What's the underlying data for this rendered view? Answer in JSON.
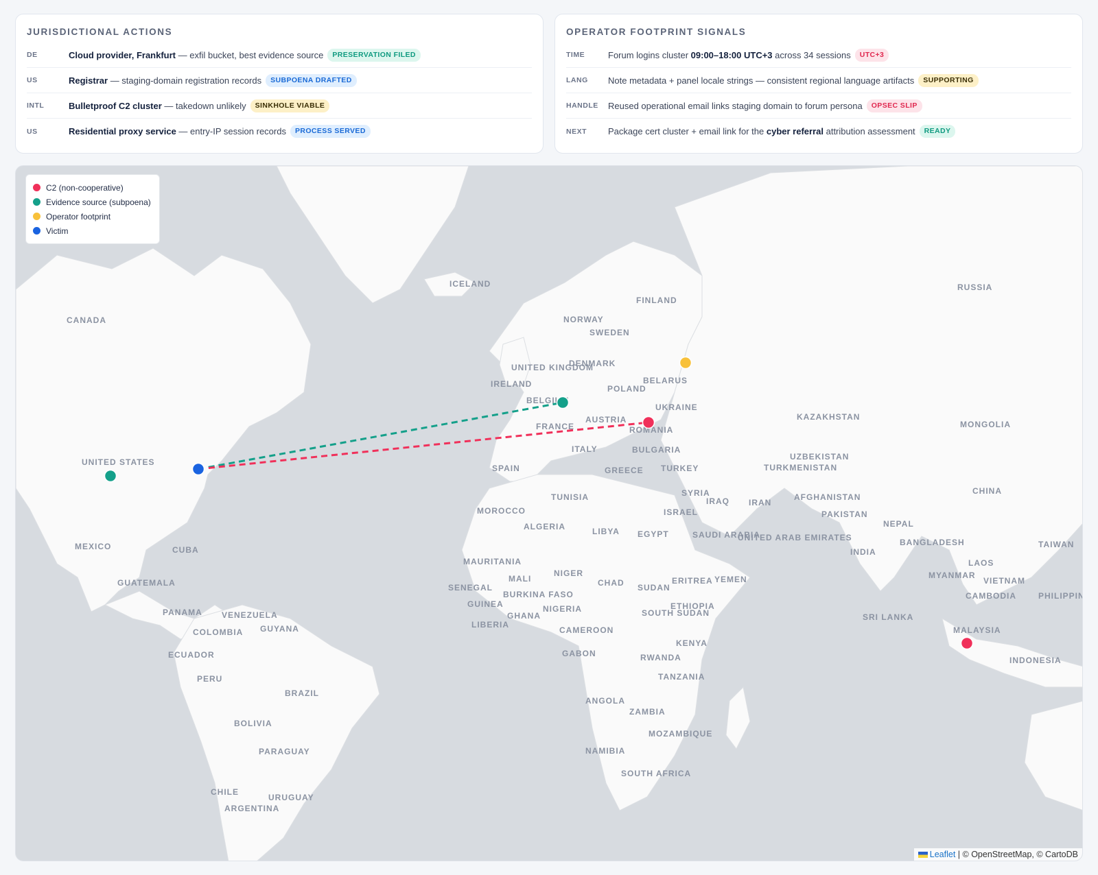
{
  "jurisdictional": {
    "title": "JURISDICTIONAL ACTIONS",
    "rows": [
      {
        "code": "DE",
        "bold": "Cloud provider, Frankfurt",
        "text": " — exfil bucket, best evidence source",
        "badge": "PRESERVATION FILED",
        "badge_color": "#0f9a80"
      },
      {
        "code": "US",
        "bold": "Registrar",
        "text": " — staging-domain registration records",
        "badge": "SUBPOENA DRAFTED",
        "badge_color": "#1a6ad6"
      },
      {
        "code": "INTL",
        "bold": "Bulletproof C2 cluster",
        "text": " — takedown unlikely",
        "badge": "SINKHOLE VIABLE",
        "badge_color": "#3a2e05"
      },
      {
        "code": "US",
        "bold": "Residential proxy service",
        "text": " — entry-IP session records",
        "badge": "PROCESS SERVED",
        "badge_color": "#1a6ad6"
      }
    ]
  },
  "footprint": {
    "title": "OPERATOR FOOTPRINT SIGNALS",
    "rows": [
      {
        "code": "TIME",
        "pre": "Forum logins cluster ",
        "bold": "09:00–18:00 UTC+3",
        "post": " across 34 sessions",
        "badge": "UTC+3"
      },
      {
        "code": "LANG",
        "pre": "Note metadata + panel locale strings — consistent regional language artifacts",
        "bold": "",
        "post": "",
        "badge": "SUPPORTING"
      },
      {
        "code": "HANDLE",
        "pre": "Reused operational email links staging domain to forum persona",
        "bold": "",
        "post": "",
        "badge": "OPSEC SLIP"
      },
      {
        "code": "NEXT",
        "pre": "Package cert cluster + email link for the ",
        "bold": "cyber referral",
        "post": " attribution assessment",
        "badge": "READY"
      }
    ]
  },
  "legend": {
    "items": [
      {
        "label": "C2 (non-cooperative)",
        "color": "#f0305a"
      },
      {
        "label": "Evidence source (subpoena)",
        "color": "#14a08a"
      },
      {
        "label": "Operator footprint",
        "color": "#f8c13a"
      },
      {
        "label": "Victim",
        "color": "#1a63e0"
      }
    ]
  },
  "map_labels": [
    "ICELAND",
    "RUSSIA",
    "FINLAND",
    "CANADA",
    "NORWAY",
    "SWEDEN",
    "UNITED KINGDOM",
    "IRELAND",
    "DENMARK",
    "BELARUS",
    "POLAND",
    "BELGIUM",
    "UKRAINE",
    "KAZAKHSTAN",
    "MONGOLIA",
    "AUSTRIA",
    "FRANCE",
    "ROMANIA",
    "ITALY",
    "BULGARIA",
    "UZBEKISTAN",
    "TURKMENISTAN",
    "UNITED STATES",
    "SPAIN",
    "GREECE",
    "TURKEY",
    "CHINA",
    "SYRIA",
    "IRAQ",
    "IRAN",
    "AFGHANISTAN",
    "TUNISIA",
    "ISRAEL",
    "PAKISTAN",
    "MOROCCO",
    "ALGERIA",
    "LIBYA",
    "EGYPT",
    "SAUDI ARABIA",
    "UNITED ARAB EMIRATES",
    "NEPAL",
    "BANGLADESH",
    "INDIA",
    "TAIWAN",
    "MEXICO",
    "CUBA",
    "LAOS",
    "MAURITANIA",
    "MALI",
    "NIGER",
    "MYANMAR",
    "VIETNAM",
    "GUATEMALA",
    "SENEGAL",
    "CHAD",
    "SUDAN",
    "ERITREA",
    "YEMEN",
    "BURKINA FASO",
    "GUINEA",
    "CAMBODIA",
    "NIGERIA",
    "ETHIOPIA",
    "PANAMA",
    "VENEZUELA",
    "GHANA",
    "SOUTH SUDAN",
    "SRI LANKA",
    "COLOMBIA",
    "GUYANA",
    "LIBERIA",
    "CAMEROON",
    "MALAYSIA",
    "KENYA",
    "ECUADOR",
    "GABON",
    "RWANDA",
    "INDONESIA",
    "PERU",
    "TANZANIA",
    "BRAZIL",
    "ANGOLA",
    "ZAMBIA",
    "BOLIVIA",
    "MOZAMBIQUE",
    "NAMIBIA",
    "PARAGUAY",
    "SOUTH AFRICA",
    "CHILE",
    "URUGUAY",
    "ARGENTINA",
    "PHILIPPINES"
  ],
  "attribution": {
    "leaflet": "Leaflet",
    "rest": " | © OpenStreetMap, © CartoDB"
  }
}
